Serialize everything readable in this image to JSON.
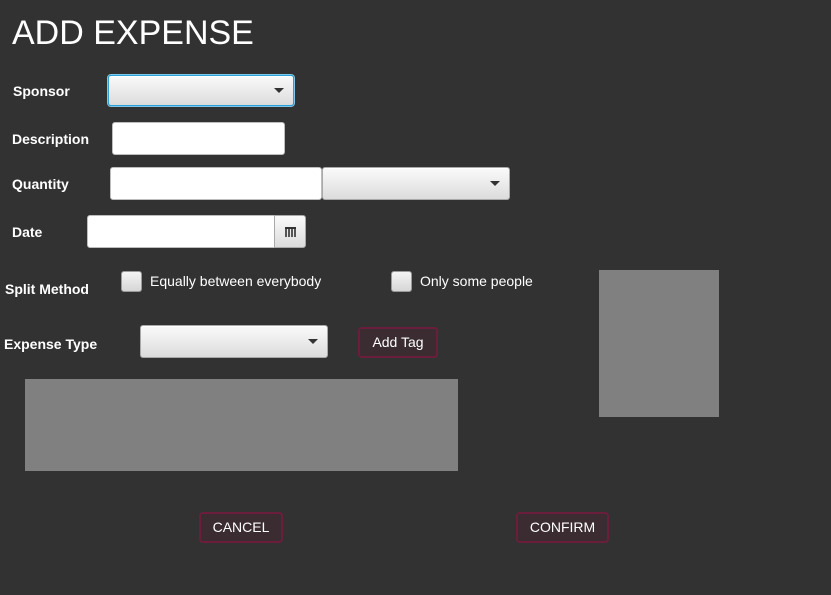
{
  "title": "ADD EXPENSE",
  "sponsor": {
    "label": "Sponsor",
    "value": ""
  },
  "description": {
    "label": "Description",
    "value": ""
  },
  "quantity": {
    "label": "Quantity",
    "value": "",
    "unit_value": ""
  },
  "date": {
    "label": "Date",
    "value": ""
  },
  "split_method": {
    "label": "Split Method",
    "option_equal": "Equally between everybody",
    "option_some": "Only some people"
  },
  "expense_type": {
    "label": "Expense Type",
    "value": ""
  },
  "add_tag_label": "Add Tag",
  "cancel_label": "CANCEL",
  "confirm_label": "CONFIRM",
  "colors": {
    "background": "#323232",
    "button_border": "#6b1e3c",
    "panel": "#808080",
    "focus": "#2b9fd6"
  }
}
